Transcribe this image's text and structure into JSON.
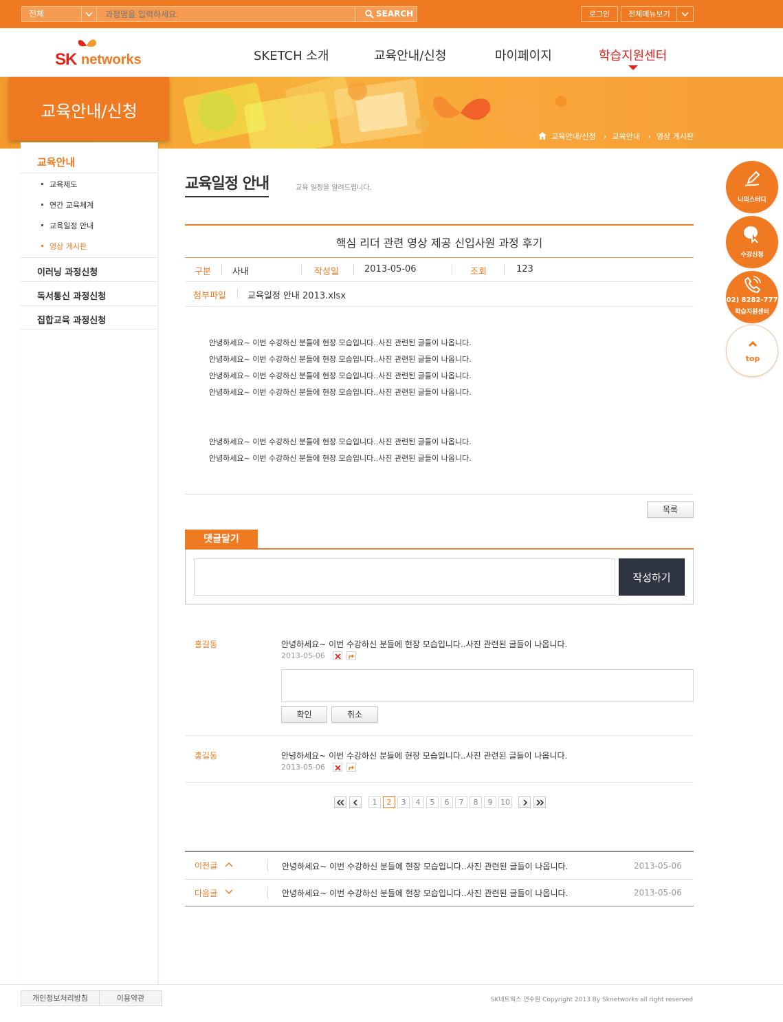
{
  "topbar": {
    "scope": "전체",
    "search_placeholder": "과정명을 입력하세요.",
    "search_label": "SEARCH",
    "login": "로그인",
    "all_menu": "전체메뉴보기"
  },
  "brand": {
    "sk": "SK",
    "name": "networks"
  },
  "nav": [
    {
      "label": "SKETCH 소개"
    },
    {
      "label": "교육안내/신청"
    },
    {
      "label": "마이페이지"
    },
    {
      "label": "학습지원센터",
      "active": true
    }
  ],
  "banner": {
    "title": "교육안내/신청",
    "breadcrumb": [
      "교육안내/신청",
      "교육안내",
      "영상 게시판"
    ]
  },
  "sidebar": {
    "heading": "교육안내",
    "sub_items": [
      {
        "label": "교육제도"
      },
      {
        "label": "연간 교육체계"
      },
      {
        "label": "교육일정 안내"
      },
      {
        "label": "영상 게시판",
        "active": true
      }
    ],
    "menus": [
      {
        "label": "이러닝 과정신청"
      },
      {
        "label": "독서통신 과정신청"
      },
      {
        "label": "집합교육 과정신청"
      }
    ]
  },
  "page": {
    "title": "교육일정 안내",
    "desc": "교육 일정을 알려드립니다."
  },
  "post": {
    "title": "핵심 리더 관련 영상 제공 신입사원 과정 후기",
    "category_label": "구분",
    "category": "사내",
    "date_label": "작성일",
    "date": "2013-05-06",
    "views_label": "조회",
    "views": "123",
    "file_label": "첨부파일",
    "file": "교육일정 안내 2013.xlsx",
    "body": [
      "안녕하세요~ 이번 수강하신 분들에 현장 모습입니다..사진 관련된 글들이 나옵니다.",
      "안녕하세요~ 이번 수강하신 분들에 현장 모습입니다..사진 관련된 글들이 나옵니다.",
      "안녕하세요~ 이번 수강하신 분들에 현장 모습입니다..사진 관련된 글들이 나옵니다.",
      "안녕하세요~ 이번 수강하신 분들에 현장 모습입니다..사진 관련된 글들이 나옵니다.",
      "안녕하세요~ 이번 수강하신 분들에 현장 모습입니다..사진 관련된 글들이 나옵니다.",
      "안녕하세요~ 이번 수강하신 분들에 현장 모습입니다..사진 관련된 글들이 나옵니다."
    ],
    "list_button": "목록"
  },
  "reply": {
    "tab": "댓글달기",
    "write_button": "작성하기",
    "confirm": "확인",
    "cancel": "취소"
  },
  "comments": [
    {
      "name": "홍길동",
      "text": "안녕하세요~ 이번 수강하신 분들에 현장 모습입니다..사진 관련된 글들이 나옵니다.",
      "date": "2013-05-06"
    },
    {
      "name": "홍길동",
      "text": "안녕하세요~ 이번 수강하신 분들에 현장 모습입니다..사진 관련된 글들이 나옵니다.",
      "date": "2013-05-06"
    }
  ],
  "pagination": {
    "pages": [
      "1",
      "2",
      "3",
      "4",
      "5",
      "6",
      "7",
      "8",
      "9",
      "10"
    ],
    "current": "2"
  },
  "adjacent": {
    "prev_label": "이전글",
    "prev_text": "안녕하세요~ 이번 수강하신 분들에 현장 모습입니다..사진 관련된 글들이 나옵니다.",
    "prev_date": "2013-05-06",
    "next_label": "다음글",
    "next_text": "안녕하세요~ 이번 수강하신 분들에 현장 모습입니다..사진 관련된 글들이 나옵니다.",
    "next_date": "2013-05-06"
  },
  "quick_menu": {
    "study": "나의스터디",
    "apply": "수강신청",
    "phone": "02) 8282-777",
    "center": "학습지원센터",
    "top": "top"
  },
  "footer": {
    "privacy": "개인정보처리방침",
    "terms": "이용약관",
    "copyright": "SK네트웍스 연수원 Copyright 2013 By Sknetworks all right reserved"
  },
  "colors": {
    "accent": "#ef7a22",
    "active_nav": "#e2261d",
    "dark_button": "#2d3340"
  }
}
